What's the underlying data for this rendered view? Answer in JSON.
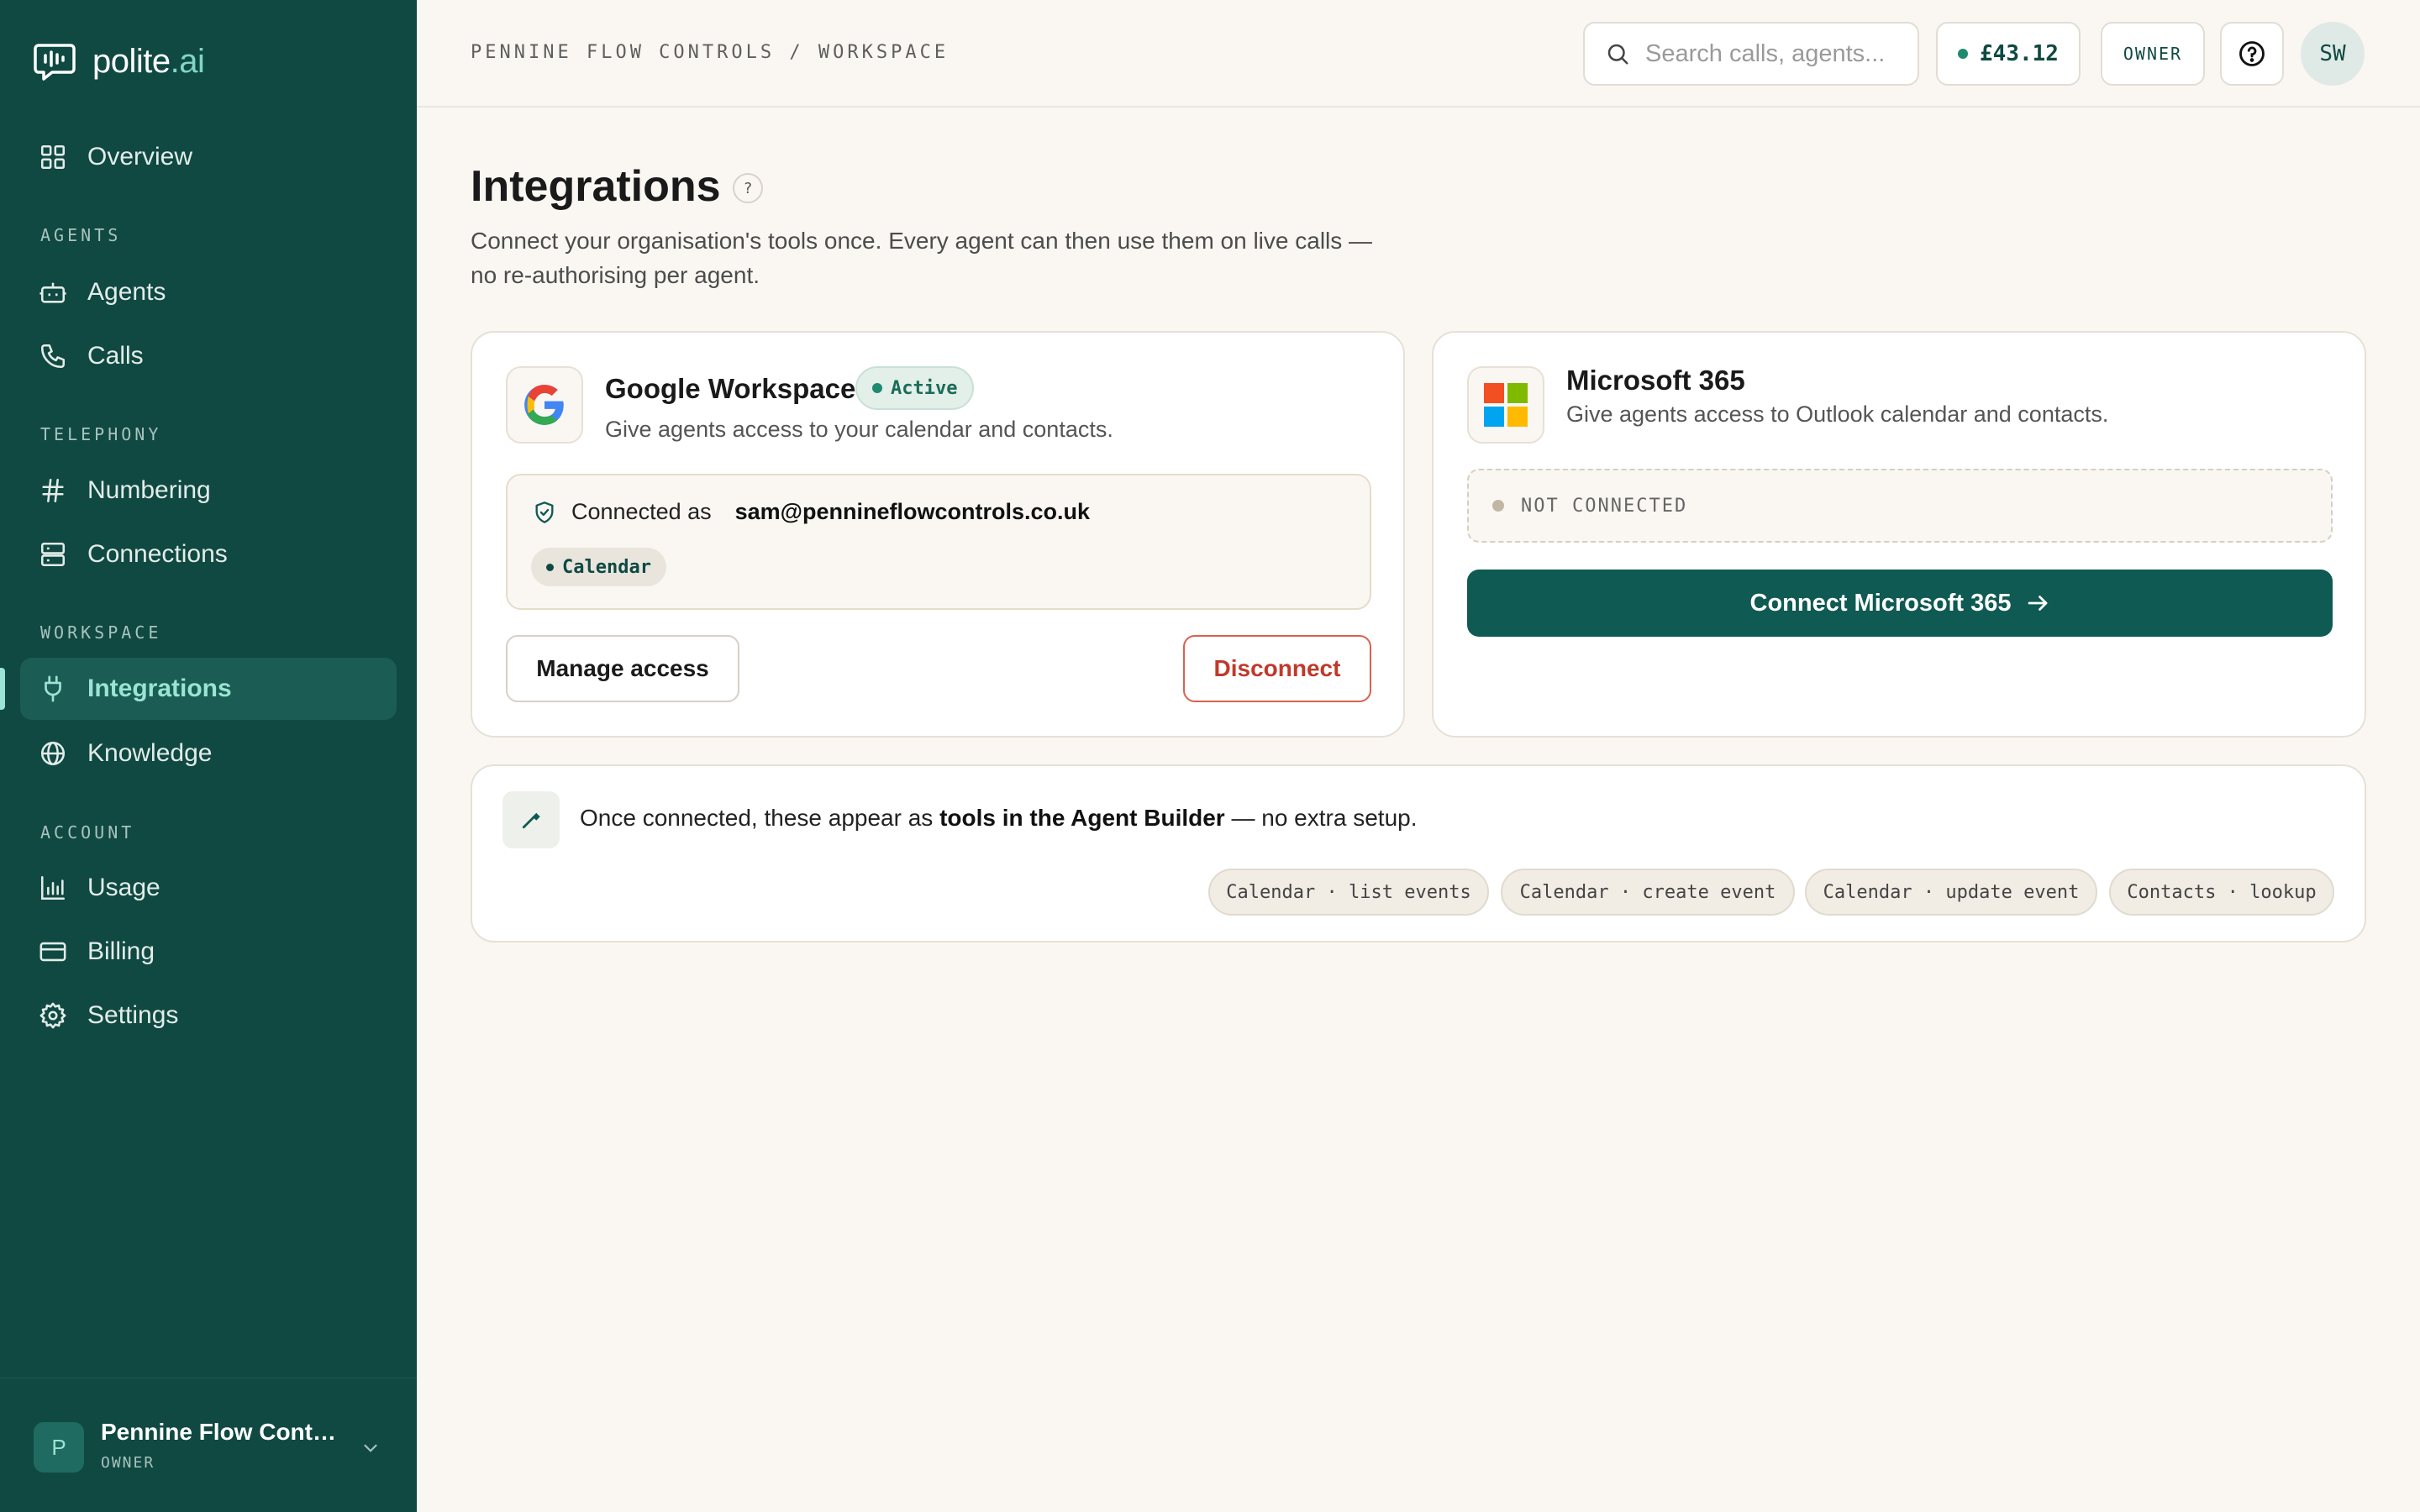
{
  "brand": {
    "name_main": "polite",
    "name_suffix": ".ai"
  },
  "sidebar": {
    "overview": "Overview",
    "sections": {
      "agents": "AGENTS",
      "telephony": "TELEPHONY",
      "workspace": "WORKSPACE",
      "account": "ACCOUNT"
    },
    "items": {
      "agents": "Agents",
      "calls": "Calls",
      "numbering": "Numbering",
      "connections": "Connections",
      "integrations": "Integrations",
      "knowledge": "Knowledge",
      "usage": "Usage",
      "billing": "Billing",
      "settings": "Settings"
    },
    "active_item": "Integrations",
    "org": {
      "avatar": "P",
      "name": "Pennine Flow Contr...",
      "role": "OWNER"
    }
  },
  "topbar": {
    "breadcrumb": "PENNINE FLOW CONTROLS / WORKSPACE",
    "search_placeholder": "Search calls, agents...",
    "balance": "£43.12",
    "role_badge": "OWNER",
    "user_initials": "SW"
  },
  "page": {
    "title": "Integrations",
    "title_help": "?",
    "subtitle": "Connect your organisation's tools once. Every agent can then use them on live calls — no re-authorising per agent."
  },
  "google": {
    "title": "Google Workspace",
    "status": "Active",
    "description": "Give agents access to your calendar and contacts.",
    "connected_as_label": "Connected as",
    "email": "sam@pennineflowcontrols.co.uk",
    "scope_chip": "Calendar",
    "manage_label": "Manage access",
    "disconnect_label": "Disconnect"
  },
  "microsoft": {
    "title": "Microsoft 365",
    "description": "Give agents access to Outlook calendar and contacts.",
    "status": "NOT CONNECTED",
    "connect_label": "Connect Microsoft 365"
  },
  "info": {
    "text_before": "Once connected, these appear as ",
    "text_bold": "tools in the Agent Builder",
    "text_after": " — no extra setup.",
    "tools": [
      "Calendar · list events",
      "Calendar · create event",
      "Calendar · update event",
      "Contacts · lookup"
    ]
  },
  "colors": {
    "sidebar_bg": "#0f4942",
    "accent": "#9be3d2",
    "primary_button": "#0f5a52",
    "danger": "#c0392b",
    "page_bg": "#faf7f2"
  },
  "icons": {
    "logo": "chat-bubble-icon",
    "overview": "grid-icon",
    "agents": "robot-icon",
    "calls": "phone-icon",
    "numbering": "hash-icon",
    "connections": "server-icon",
    "integrations": "plug-icon",
    "knowledge": "globe-icon",
    "usage": "bar-chart-icon",
    "billing": "credit-card-icon",
    "settings": "gear-icon"
  }
}
